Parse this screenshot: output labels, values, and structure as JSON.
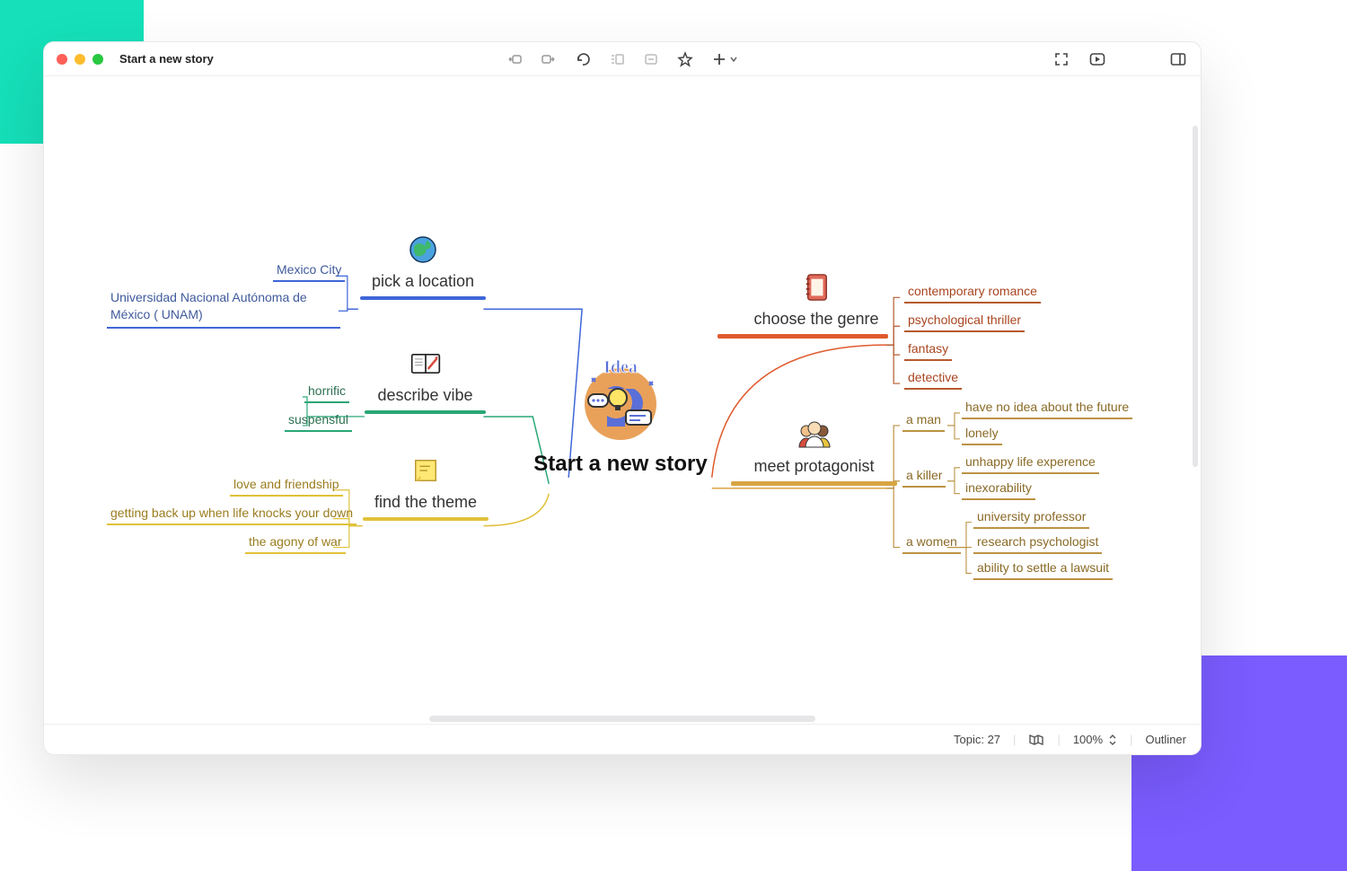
{
  "window": {
    "title": "Start a new story"
  },
  "root": {
    "title": "Start a new story"
  },
  "left": {
    "location": {
      "label": "pick a location",
      "color": "#3f66d8",
      "children": [
        {
          "label": "Mexico City"
        },
        {
          "label": "Universidad Nacional Autónoma de México ( UNAM)"
        }
      ]
    },
    "vibe": {
      "label": "describe vibe",
      "color": "#29a776",
      "children": [
        {
          "label": "horrific"
        },
        {
          "label": "suspensful"
        }
      ]
    },
    "theme": {
      "label": "find the theme",
      "color": "#e0c139",
      "children": [
        {
          "label": "love and friendship"
        },
        {
          "label": "getting back up when life knocks your down"
        },
        {
          "label": "the agony of war"
        }
      ]
    }
  },
  "right": {
    "genre": {
      "label": "choose the genre",
      "color": "#e05a2d",
      "children": [
        {
          "label": "contemporary romance"
        },
        {
          "label": "psychological thriller"
        },
        {
          "label": "fantasy"
        },
        {
          "label": "detective"
        }
      ]
    },
    "protagonist": {
      "label": "meet protagonist",
      "color": "#d8a542",
      "children": [
        {
          "label": "a  man",
          "children": [
            {
              "label": "have no idea about the future"
            },
            {
              "label": "lonely"
            }
          ]
        },
        {
          "label": "a  killer",
          "children": [
            {
              "label": "unhappy life experence"
            },
            {
              "label": "inexorability"
            }
          ]
        },
        {
          "label": "a women",
          "children": [
            {
              "label": "university professor"
            },
            {
              "label": "research psychologist"
            },
            {
              "label": "ability to settle a lawsuit"
            }
          ]
        }
      ]
    }
  },
  "status": {
    "topic_label": "Topic:",
    "topic_count": "27",
    "zoom": "100%",
    "outliner": "Outliner"
  }
}
